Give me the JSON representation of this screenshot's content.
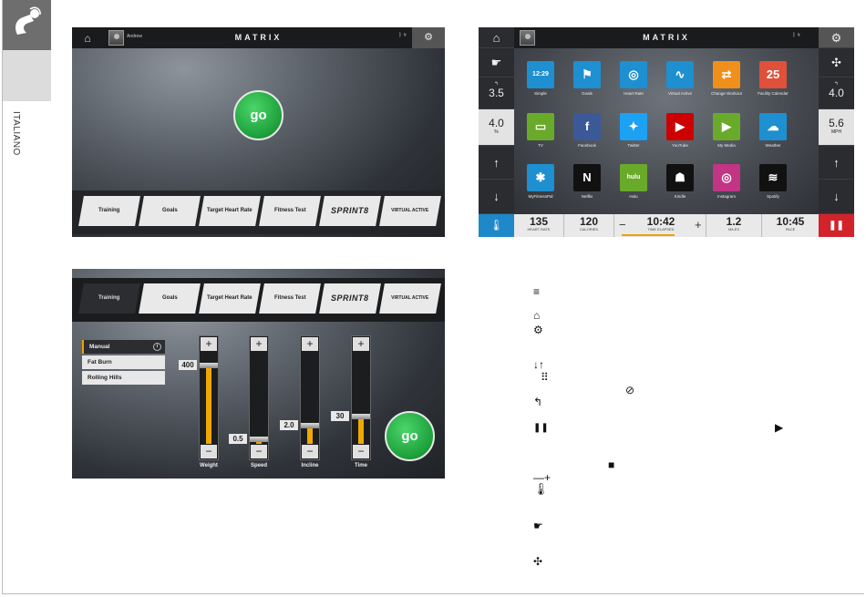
{
  "sidebar": {
    "language": "ITALIANO"
  },
  "screen1": {
    "user": "Andrew",
    "brand": "MATRIX",
    "go_label": "go",
    "tabs": [
      "Training",
      "Goals",
      "Target Heart Rate",
      "Fitness Test",
      "SPRINT8",
      "VIRTUAL ACTIVE"
    ]
  },
  "screen2": {
    "tabs": [
      "Training",
      "Goals",
      "Target Heart Rate",
      "Fitness Test",
      "SPRINT8",
      "VIRTUAL ACTIVE"
    ],
    "programs": [
      "Manual",
      "Fat Burn",
      "Rolling Hills"
    ],
    "sliders": [
      {
        "label": "Weight",
        "value": "400",
        "level": 0.85
      },
      {
        "label": "Speed",
        "value": "0.5",
        "level": 0.05
      },
      {
        "label": "Incline",
        "value": "2.0",
        "level": 0.2
      },
      {
        "label": "Time",
        "value": "30",
        "level": 0.3
      }
    ],
    "go_label": "go"
  },
  "screen3": {
    "brand": "MATRIX",
    "left_values": {
      "back": "3.5",
      "incline": "4.0",
      "incline_unit": "%"
    },
    "right_values": {
      "back": "4.0",
      "speed": "5.6",
      "speed_unit": "MPH"
    },
    "apps": [
      {
        "label": "Simple",
        "color": "#1e8fd0",
        "glyph": "12:29"
      },
      {
        "label": "Goals",
        "color": "#1e8fd0",
        "glyph": "⚑"
      },
      {
        "label": "Heart Rate",
        "color": "#1e8fd0",
        "glyph": "◎"
      },
      {
        "label": "Virtual Active",
        "color": "#1e8fd0",
        "glyph": "∿"
      },
      {
        "label": "Change Workout",
        "color": "#f0901a",
        "glyph": "⇄"
      },
      {
        "label": "Facility Calendar",
        "color": "#e0503a",
        "glyph": "25"
      },
      {
        "label": "TV",
        "color": "#6aaa2a",
        "glyph": "▭"
      },
      {
        "label": "Facebook",
        "color": "#3b5998",
        "glyph": "f"
      },
      {
        "label": "Twitter",
        "color": "#1da1f2",
        "glyph": "✦"
      },
      {
        "label": "YouTube",
        "color": "#cc0000",
        "glyph": "▶"
      },
      {
        "label": "My Media",
        "color": "#6aaa2a",
        "glyph": "▶"
      },
      {
        "label": "Weather",
        "color": "#1e8fd0",
        "glyph": "☁"
      },
      {
        "label": "MyFitnessPal",
        "color": "#1e8fd0",
        "glyph": "✱"
      },
      {
        "label": "Netflix",
        "color": "#111111",
        "glyph": "N"
      },
      {
        "label": "Hulu",
        "color": "#6aaa2a",
        "glyph": "hulu"
      },
      {
        "label": "Kindle",
        "color": "#111111",
        "glyph": "☗"
      },
      {
        "label": "Instagram",
        "color": "#c13584",
        "glyph": "◎"
      },
      {
        "label": "Spotify",
        "color": "#111111",
        "glyph": "≋"
      }
    ],
    "stats": [
      {
        "value": "135",
        "label": "HEART RATE"
      },
      {
        "value": "120",
        "label": "CALORIES"
      },
      {
        "value": "10:42",
        "label": "TIME ELAPSED"
      },
      {
        "value": "1.2",
        "label": "MILES"
      },
      {
        "value": "10:45",
        "label": "PACE"
      }
    ]
  },
  "legend": {
    "menu": "≡",
    "home": "⌂",
    "gear": "⚙",
    "arrows": "↓↑",
    "grid": "⠿",
    "check": "⊘",
    "back": "↰",
    "pause": "❚❚",
    "play": "▶",
    "stop": "■",
    "minus_plus": "—+",
    "thermo": "🌡",
    "hand": "☛",
    "fan": "✣"
  }
}
